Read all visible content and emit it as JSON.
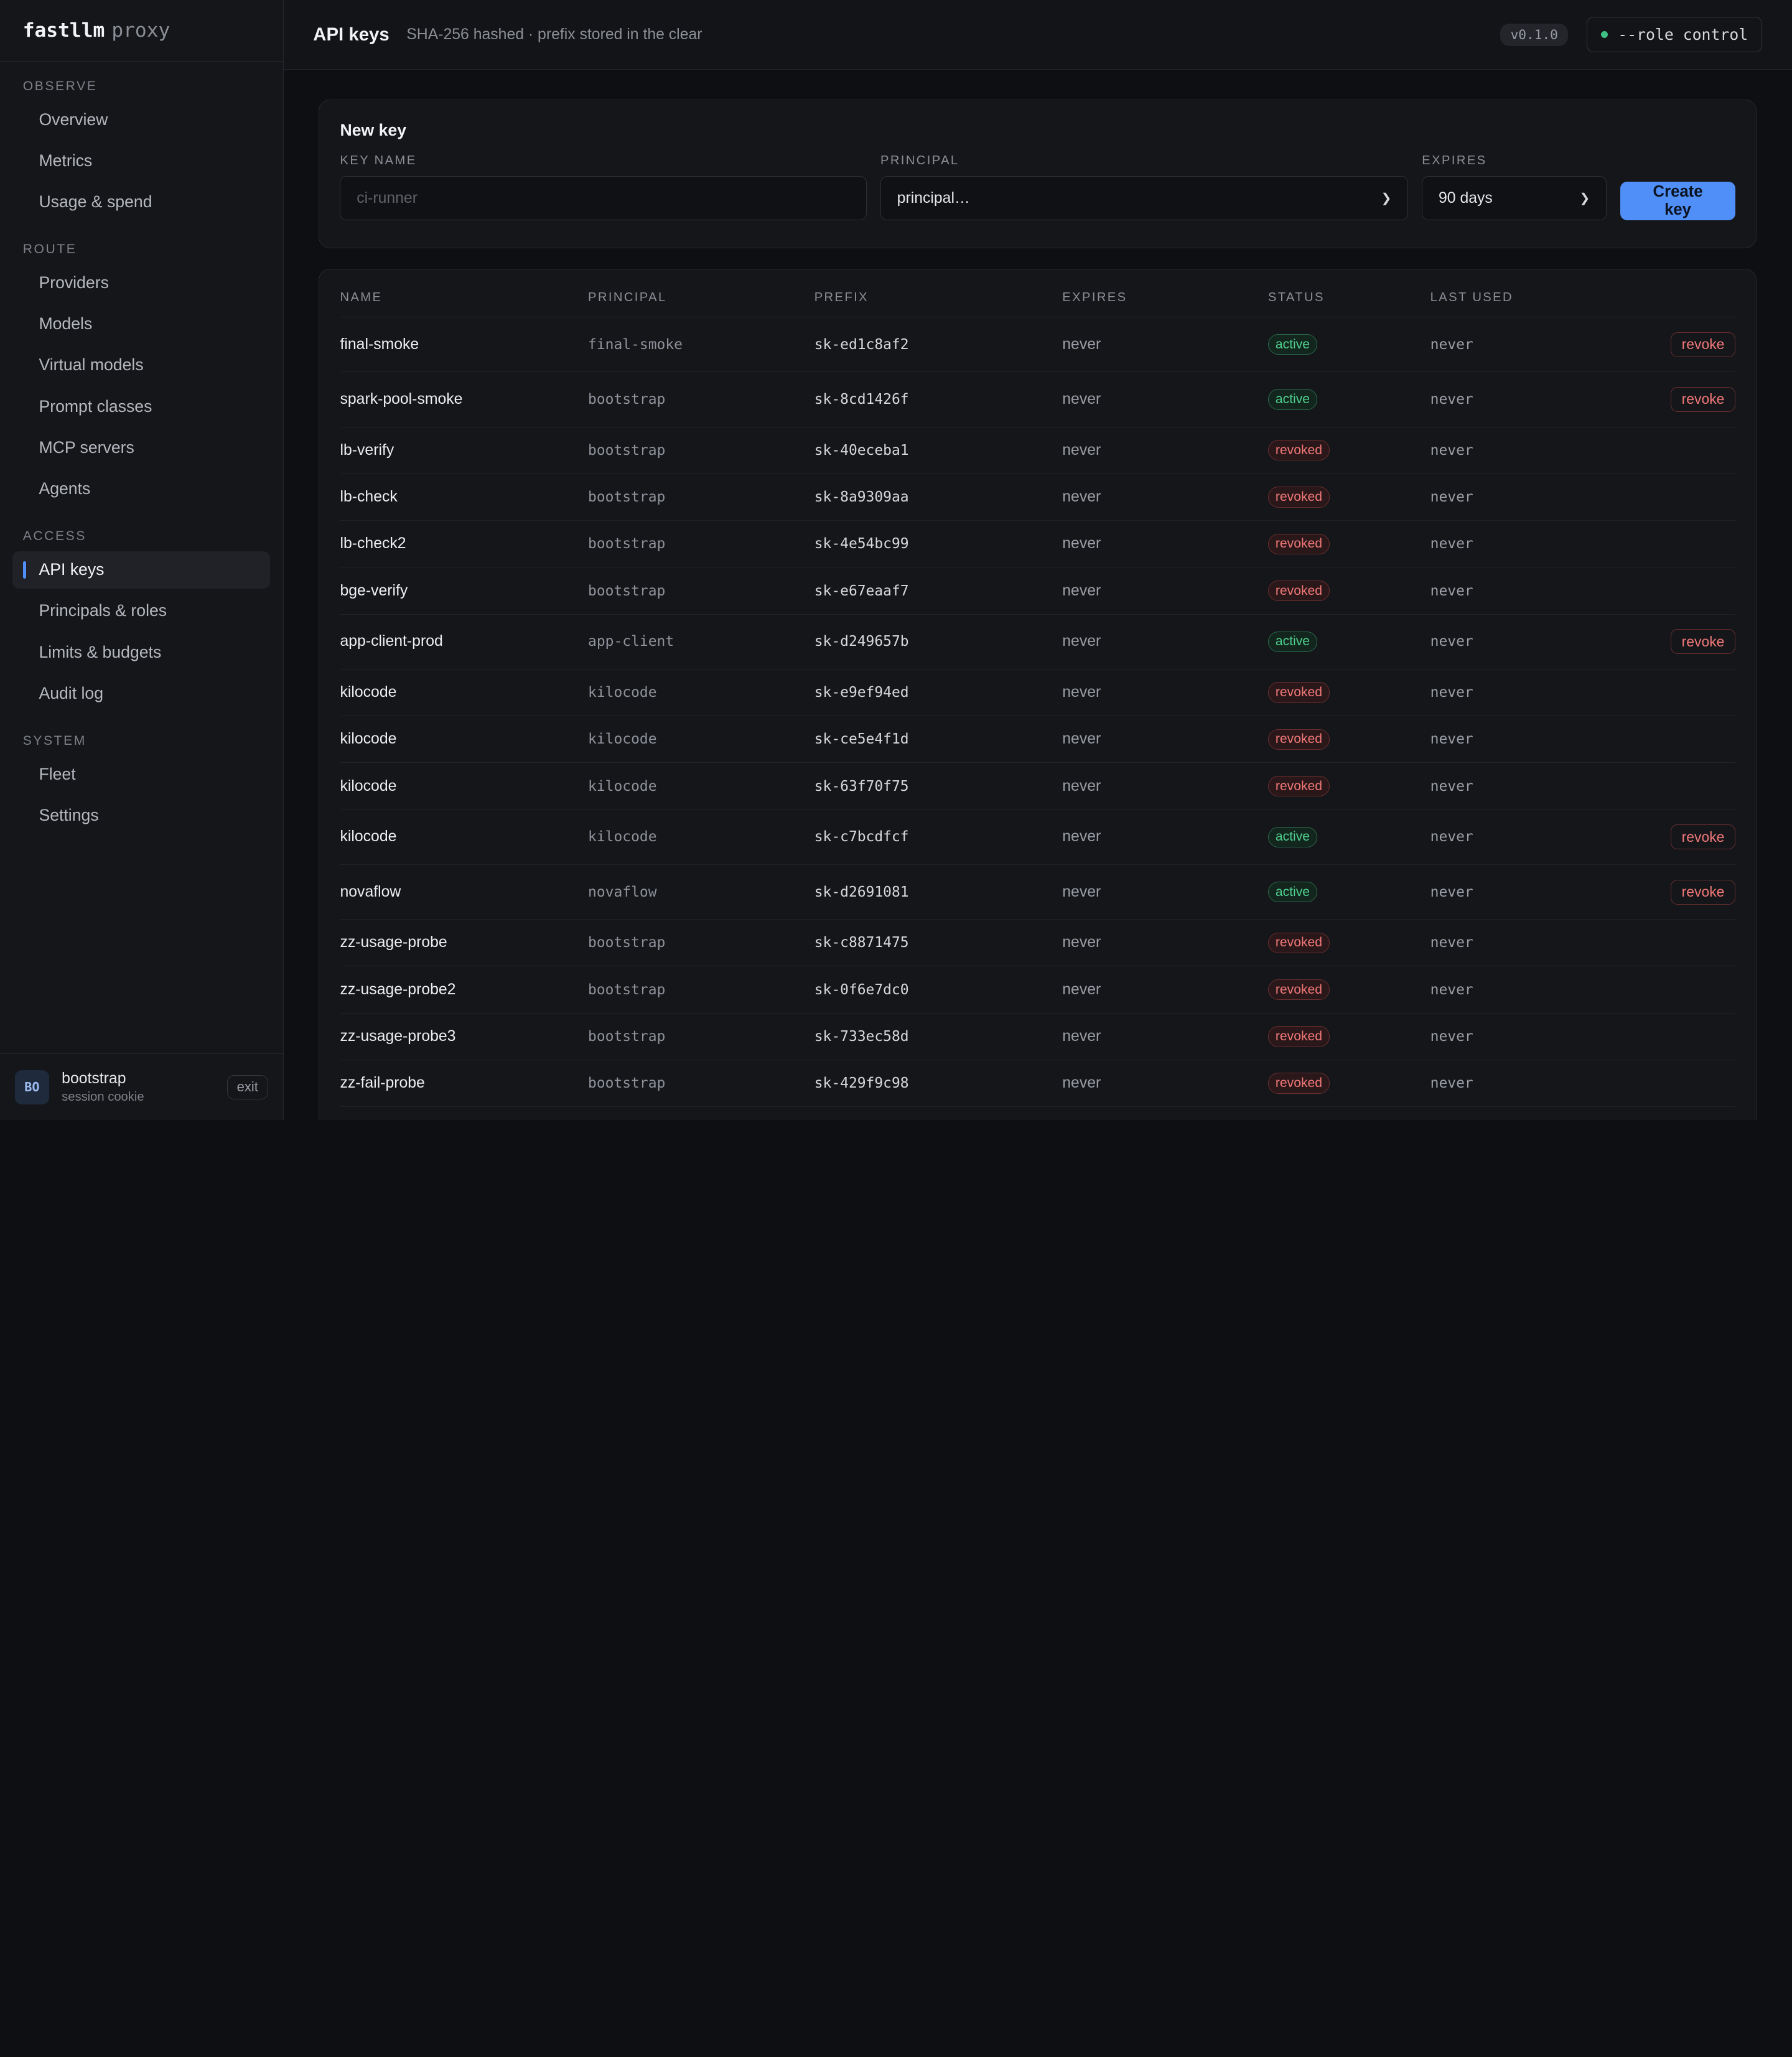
{
  "brand": {
    "name": "fastllm",
    "suffix": "proxy"
  },
  "sidebar": {
    "sections": [
      {
        "header": "OBSERVE",
        "items": [
          "Overview",
          "Metrics",
          "Usage & spend"
        ]
      },
      {
        "header": "ROUTE",
        "items": [
          "Providers",
          "Models",
          "Virtual models",
          "Prompt classes",
          "MCP servers",
          "Agents"
        ]
      },
      {
        "header": "ACCESS",
        "items": [
          "API keys",
          "Principals & roles",
          "Limits & budgets",
          "Audit log"
        ]
      },
      {
        "header": "SYSTEM",
        "items": [
          "Fleet",
          "Settings"
        ]
      }
    ],
    "active": "API keys"
  },
  "session": {
    "initials": "BO",
    "name": "bootstrap",
    "sub": "session cookie",
    "exit": "exit"
  },
  "header": {
    "title": "API keys",
    "subtitle": "SHA-256 hashed · prefix stored in the clear",
    "version": "v0.1.0",
    "role": "--role control",
    "role_dot_color": "#3fbf84"
  },
  "newkey": {
    "title": "New key",
    "name_label": "KEY NAME",
    "name_placeholder": "ci-runner",
    "principal_label": "PRINCIPAL",
    "principal_value": "principal…",
    "expires_label": "EXPIRES",
    "expires_value": "90 days",
    "create_label": "Create key"
  },
  "table": {
    "columns": [
      "NAME",
      "PRINCIPAL",
      "PREFIX",
      "EXPIRES",
      "STATUS",
      "LAST USED"
    ],
    "revoke_label": "revoke",
    "rows": [
      {
        "name": "final-smoke",
        "principal": "final-smoke",
        "prefix": "sk-ed1c8af2",
        "expires": "never",
        "status": "active",
        "last_used": "never"
      },
      {
        "name": "spark-pool-smoke",
        "principal": "bootstrap",
        "prefix": "sk-8cd1426f",
        "expires": "never",
        "status": "active",
        "last_used": "never"
      },
      {
        "name": "lb-verify",
        "principal": "bootstrap",
        "prefix": "sk-40eceba1",
        "expires": "never",
        "status": "revoked",
        "last_used": "never"
      },
      {
        "name": "lb-check",
        "principal": "bootstrap",
        "prefix": "sk-8a9309aa",
        "expires": "never",
        "status": "revoked",
        "last_used": "never"
      },
      {
        "name": "lb-check2",
        "principal": "bootstrap",
        "prefix": "sk-4e54bc99",
        "expires": "never",
        "status": "revoked",
        "last_used": "never"
      },
      {
        "name": "bge-verify",
        "principal": "bootstrap",
        "prefix": "sk-e67eaaf7",
        "expires": "never",
        "status": "revoked",
        "last_used": "never"
      },
      {
        "name": "app-client-prod",
        "principal": "app-client",
        "prefix": "sk-d249657b",
        "expires": "never",
        "status": "active",
        "last_used": "never"
      },
      {
        "name": "kilocode",
        "principal": "kilocode",
        "prefix": "sk-e9ef94ed",
        "expires": "never",
        "status": "revoked",
        "last_used": "never"
      },
      {
        "name": "kilocode",
        "principal": "kilocode",
        "prefix": "sk-ce5e4f1d",
        "expires": "never",
        "status": "revoked",
        "last_used": "never"
      },
      {
        "name": "kilocode",
        "principal": "kilocode",
        "prefix": "sk-63f70f75",
        "expires": "never",
        "status": "revoked",
        "last_used": "never"
      },
      {
        "name": "kilocode",
        "principal": "kilocode",
        "prefix": "sk-c7bcdfcf",
        "expires": "never",
        "status": "active",
        "last_used": "never"
      },
      {
        "name": "novaflow",
        "principal": "novaflow",
        "prefix": "sk-d2691081",
        "expires": "never",
        "status": "active",
        "last_used": "never"
      },
      {
        "name": "zz-usage-probe",
        "principal": "bootstrap",
        "prefix": "sk-c8871475",
        "expires": "never",
        "status": "revoked",
        "last_used": "never"
      },
      {
        "name": "zz-usage-probe2",
        "principal": "bootstrap",
        "prefix": "sk-0f6e7dc0",
        "expires": "never",
        "status": "revoked",
        "last_used": "never"
      },
      {
        "name": "zz-usage-probe3",
        "principal": "bootstrap",
        "prefix": "sk-733ec58d",
        "expires": "never",
        "status": "revoked",
        "last_used": "never"
      },
      {
        "name": "zz-fail-probe",
        "principal": "bootstrap",
        "prefix": "sk-429f9c98",
        "expires": "never",
        "status": "revoked",
        "last_used": "never"
      }
    ]
  },
  "colors": {
    "accent": "#4f8ff7",
    "active": "#4fd08f",
    "revoked": "#f07878"
  }
}
